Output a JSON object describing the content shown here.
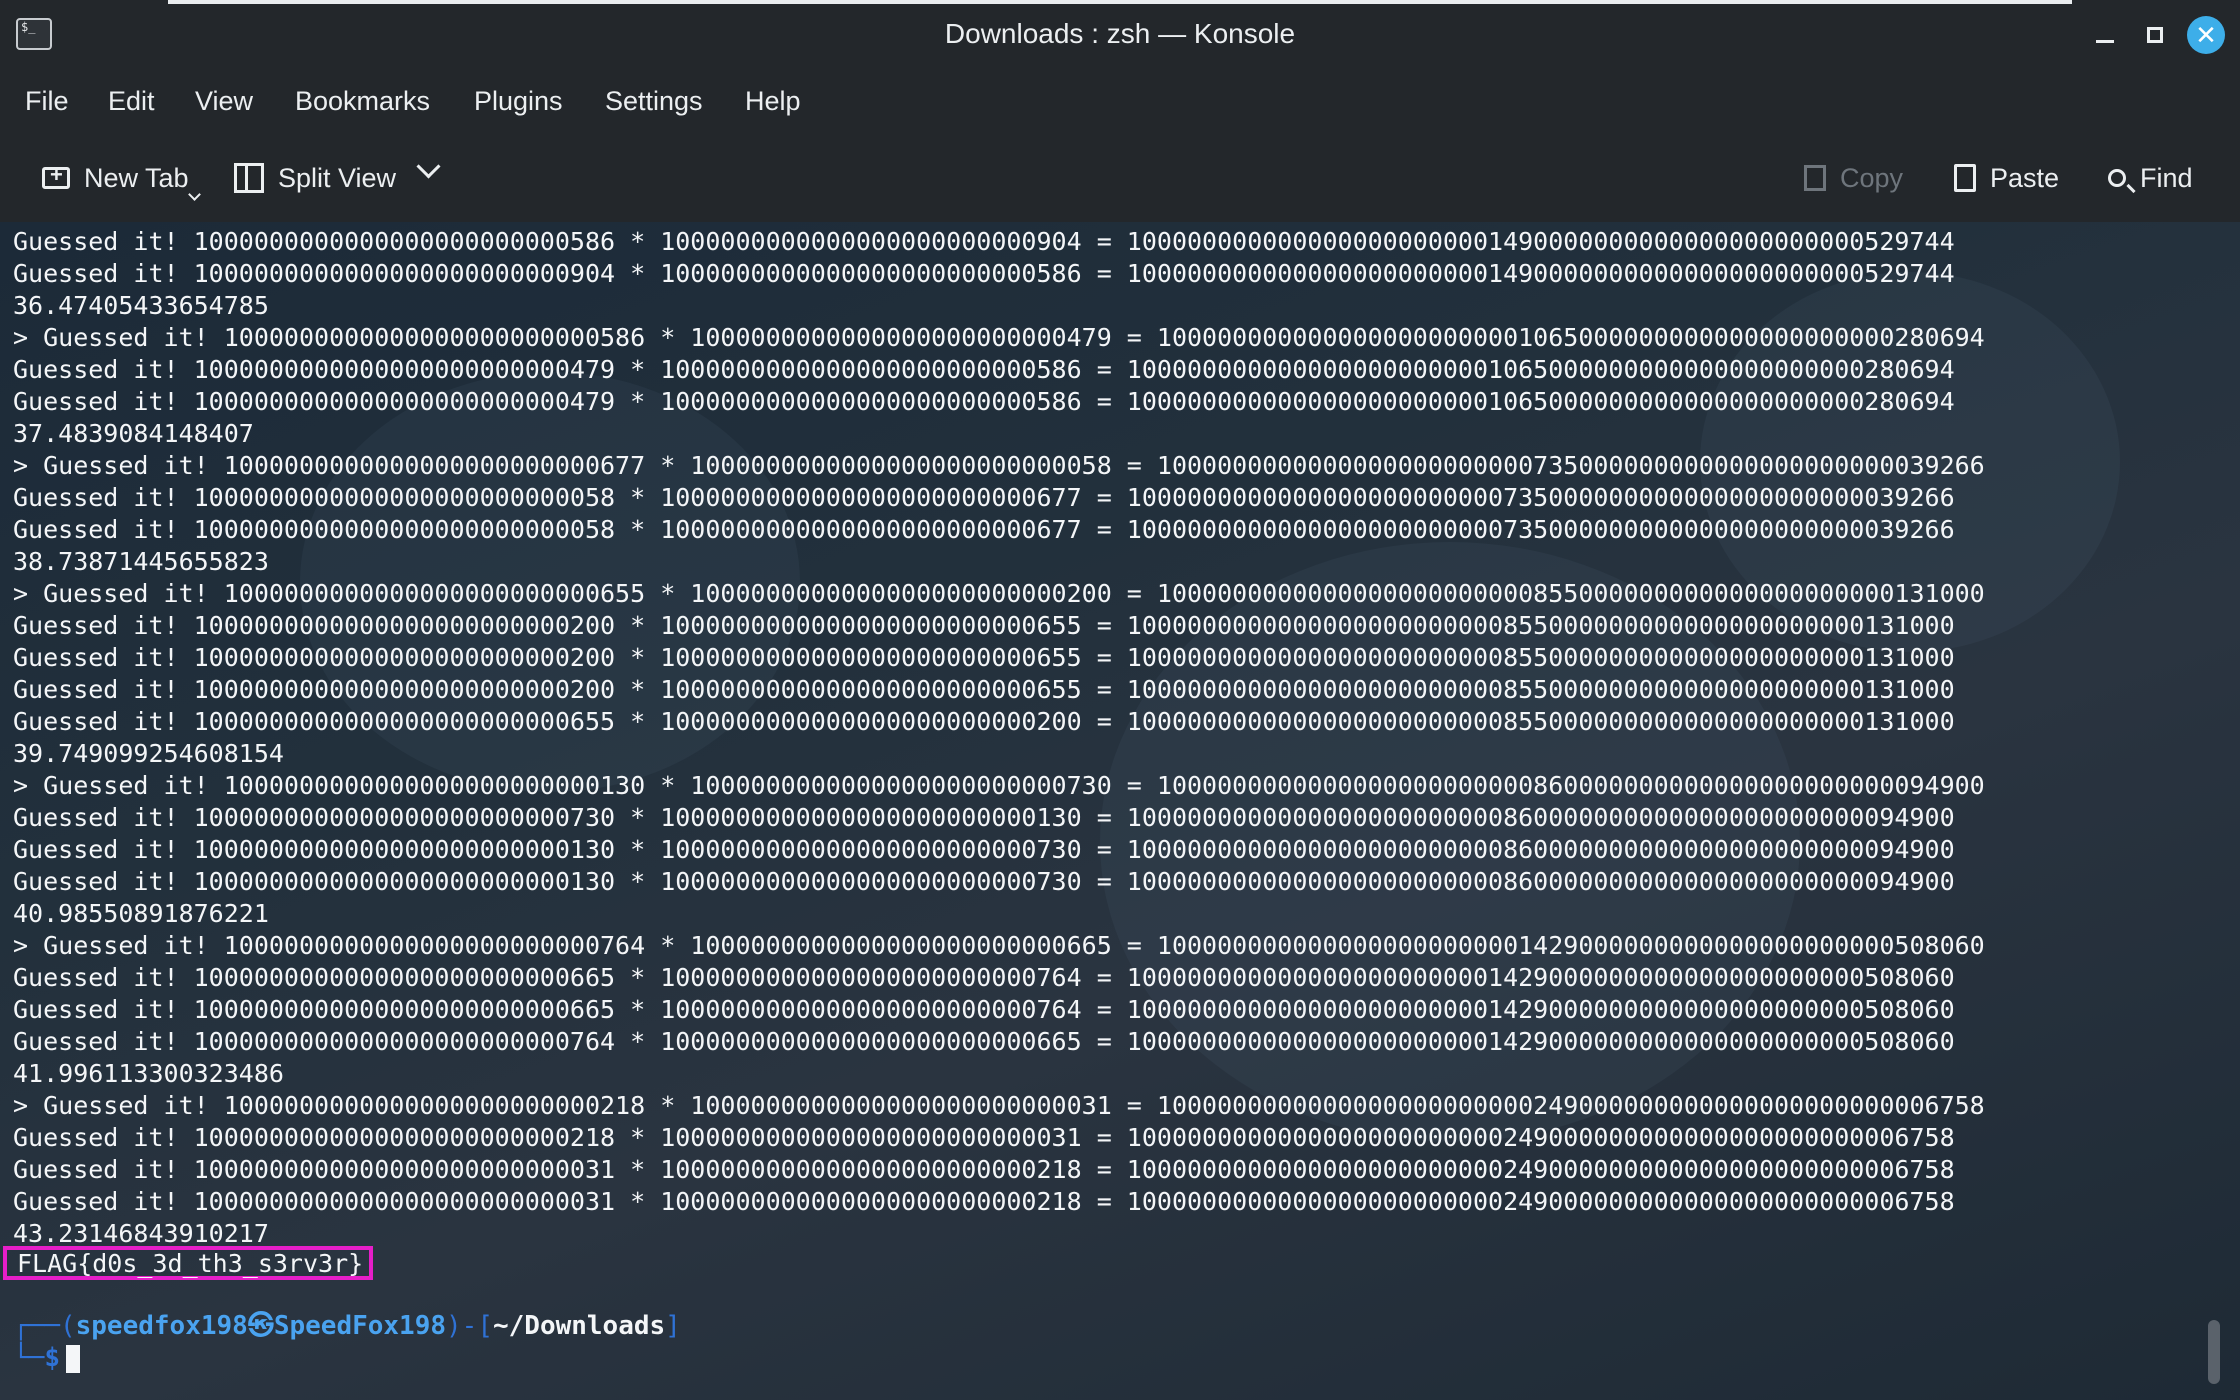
{
  "window": {
    "title": "Downloads : zsh — Konsole",
    "icons": {
      "app": "terminal-icon",
      "minimize": "minimize-icon",
      "maximize": "maximize-icon",
      "close": "close-icon"
    }
  },
  "menu": {
    "items": [
      "File",
      "Edit",
      "View",
      "Bookmarks",
      "Plugins",
      "Settings",
      "Help"
    ]
  },
  "toolbar": {
    "new_tab": "New Tab",
    "split_view": "Split View",
    "copy": "Copy",
    "paste": "Paste",
    "find": "Find"
  },
  "terminal": {
    "lines": [
      "Guessed it! 1000000000000000000000000586 * 1000000000000000000000000904 = 1000000000000000000000001490000000000000000000000529744",
      "Guessed it! 1000000000000000000000000904 * 1000000000000000000000000586 = 1000000000000000000000001490000000000000000000000529744",
      "36.47405433654785",
      "> Guessed it! 1000000000000000000000000586 * 1000000000000000000000000479 = 1000000000000000000000001065000000000000000000000280694",
      "Guessed it! 1000000000000000000000000479 * 1000000000000000000000000586 = 1000000000000000000000001065000000000000000000000280694",
      "Guessed it! 1000000000000000000000000479 * 1000000000000000000000000586 = 1000000000000000000000001065000000000000000000000280694",
      "37.4839084148407",
      "> Guessed it! 1000000000000000000000000677 * 1000000000000000000000000058 = 1000000000000000000000000735000000000000000000000039266",
      "Guessed it! 1000000000000000000000000058 * 1000000000000000000000000677 = 1000000000000000000000000735000000000000000000000039266",
      "Guessed it! 1000000000000000000000000058 * 1000000000000000000000000677 = 1000000000000000000000000735000000000000000000000039266",
      "38.73871445655823",
      "> Guessed it! 1000000000000000000000000655 * 1000000000000000000000000200 = 1000000000000000000000000855000000000000000000000131000",
      "Guessed it! 1000000000000000000000000200 * 1000000000000000000000000655 = 1000000000000000000000000855000000000000000000000131000",
      "Guessed it! 1000000000000000000000000200 * 1000000000000000000000000655 = 1000000000000000000000000855000000000000000000000131000",
      "Guessed it! 1000000000000000000000000200 * 1000000000000000000000000655 = 1000000000000000000000000855000000000000000000000131000",
      "Guessed it! 1000000000000000000000000655 * 1000000000000000000000000200 = 1000000000000000000000000855000000000000000000000131000",
      "39.749099254608154",
      "> Guessed it! 1000000000000000000000000130 * 1000000000000000000000000730 = 1000000000000000000000000860000000000000000000000094900",
      "Guessed it! 1000000000000000000000000730 * 1000000000000000000000000130 = 1000000000000000000000000860000000000000000000000094900",
      "Guessed it! 1000000000000000000000000130 * 1000000000000000000000000730 = 1000000000000000000000000860000000000000000000000094900",
      "Guessed it! 1000000000000000000000000130 * 1000000000000000000000000730 = 1000000000000000000000000860000000000000000000000094900",
      "40.98550891876221",
      "> Guessed it! 1000000000000000000000000764 * 1000000000000000000000000665 = 1000000000000000000000001429000000000000000000000508060",
      "Guessed it! 1000000000000000000000000665 * 1000000000000000000000000764 = 1000000000000000000000001429000000000000000000000508060",
      "Guessed it! 1000000000000000000000000665 * 1000000000000000000000000764 = 1000000000000000000000001429000000000000000000000508060",
      "Guessed it! 1000000000000000000000000764 * 1000000000000000000000000665 = 1000000000000000000000001429000000000000000000000508060",
      "41.996113300323486",
      "> Guessed it! 1000000000000000000000000218 * 1000000000000000000000000031 = 1000000000000000000000000249000000000000000000000006758",
      "Guessed it! 1000000000000000000000000218 * 1000000000000000000000000031 = 1000000000000000000000000249000000000000000000000006758",
      "Guessed it! 1000000000000000000000000031 * 1000000000000000000000000218 = 1000000000000000000000000249000000000000000000000006758",
      "Guessed it! 1000000000000000000000000031 * 1000000000000000000000000218 = 1000000000000000000000000249000000000000000000000006758",
      "43.23146843910217"
    ],
    "flag": "FLAG{d0s_3d_th3_s3rv3r}",
    "prompt": {
      "open": "┌──(",
      "user": "speedfox198",
      "separator": "㉿",
      "host": "SpeedFox198",
      "mid": ")-[",
      "path": "~/Downloads",
      "close": "]",
      "corner": "└─",
      "symbol": "$"
    }
  },
  "colors": {
    "flag_highlight": "#e61ec8",
    "prompt_frame": "#2f72d6",
    "prompt_user": "#4aa3f0",
    "close_button": "#3daee9"
  }
}
